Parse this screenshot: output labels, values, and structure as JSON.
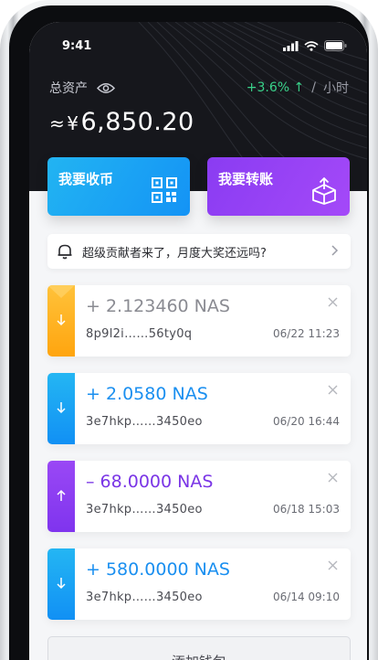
{
  "status": {
    "time": "9:41"
  },
  "header": {
    "asset_label": "总资产",
    "approx": "≈",
    "currency": "¥",
    "total": "6,850.20",
    "change_pct": "+3.6%",
    "change_arrow": "↑",
    "separator": "/",
    "period": "小时"
  },
  "actions": {
    "receive_label": "我要收币",
    "send_label": "我要转账"
  },
  "notice": {
    "text": "超级贡献者来了，月度大奖还远吗?"
  },
  "transactions": [
    {
      "amount": "+ 2.123460 NAS",
      "address": "8p9l2i……56ty0q",
      "date": "06/22 11:23",
      "direction": "in",
      "stripe_color": "#ffb21e",
      "amount_color": "#8a8b92"
    },
    {
      "amount": "+ 2.0580 NAS",
      "address": "3e7hkp……3450eo",
      "date": "06/20 16:44",
      "direction": "in",
      "stripe_color": "#1a9cf3",
      "amount_color": "#1a8ff0"
    },
    {
      "amount": "– 68.0000 NAS",
      "address": "3e7hkp……3450eo",
      "date": "06/18 15:03",
      "direction": "out",
      "stripe_color": "#8d3ff3",
      "amount_color": "#7a35e6"
    },
    {
      "amount": "+ 580.0000 NAS",
      "address": "3e7hkp……3450eo",
      "date": "06/14 09:10",
      "direction": "in",
      "stripe_color": "#1a9cf3",
      "amount_color": "#1a8ff0"
    }
  ],
  "footer": {
    "add_wallet": "添加钱包"
  },
  "colors": {
    "accent_blue": "#1493f5",
    "accent_purple": "#8a3cf2",
    "accent_orange": "#ffb21e",
    "positive": "#39d28a"
  },
  "icons": [
    "eye-icon",
    "qr-code-icon",
    "box-send-icon",
    "bell-icon",
    "chevron-right-icon",
    "close-icon",
    "arrow-down-icon",
    "arrow-up-icon",
    "signal-icon",
    "wifi-icon",
    "battery-icon"
  ]
}
